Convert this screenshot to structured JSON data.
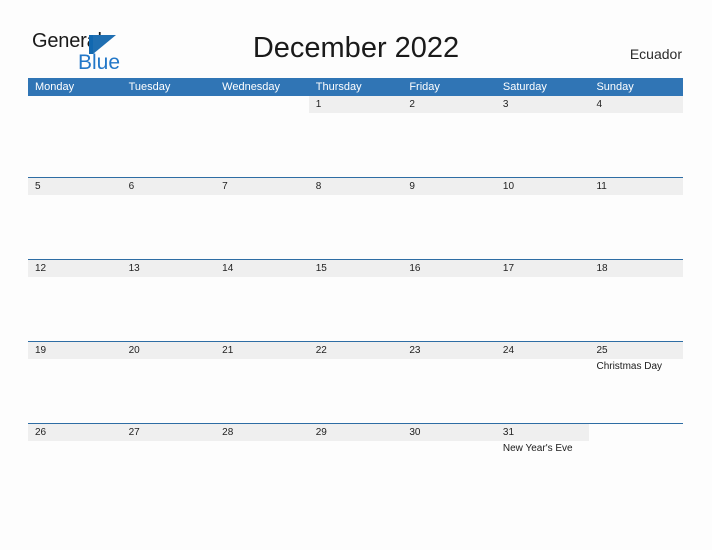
{
  "brand": {
    "name_part1": "General",
    "name_part2": "Blue",
    "mark_icon": "triangle-flag-icon",
    "accent_color": "#2277c8"
  },
  "header": {
    "title": "December 2022",
    "country": "Ecuador"
  },
  "theme": {
    "header_blue": "#3075b5",
    "rule_blue": "#2e6da4",
    "day_band_gray": "#efefef",
    "page_background": "#fdfdfd",
    "text_dark": "#222222"
  },
  "calendar": {
    "weekday_headers": [
      "Monday",
      "Tuesday",
      "Wednesday",
      "Thursday",
      "Friday",
      "Saturday",
      "Sunday"
    ],
    "weeks": [
      [
        {
          "day": "",
          "event": ""
        },
        {
          "day": "",
          "event": ""
        },
        {
          "day": "",
          "event": ""
        },
        {
          "day": "1",
          "event": ""
        },
        {
          "day": "2",
          "event": ""
        },
        {
          "day": "3",
          "event": ""
        },
        {
          "day": "4",
          "event": ""
        }
      ],
      [
        {
          "day": "5",
          "event": ""
        },
        {
          "day": "6",
          "event": ""
        },
        {
          "day": "7",
          "event": ""
        },
        {
          "day": "8",
          "event": ""
        },
        {
          "day": "9",
          "event": ""
        },
        {
          "day": "10",
          "event": ""
        },
        {
          "day": "11",
          "event": ""
        }
      ],
      [
        {
          "day": "12",
          "event": ""
        },
        {
          "day": "13",
          "event": ""
        },
        {
          "day": "14",
          "event": ""
        },
        {
          "day": "15",
          "event": ""
        },
        {
          "day": "16",
          "event": ""
        },
        {
          "day": "17",
          "event": ""
        },
        {
          "day": "18",
          "event": ""
        }
      ],
      [
        {
          "day": "19",
          "event": ""
        },
        {
          "day": "20",
          "event": ""
        },
        {
          "day": "21",
          "event": ""
        },
        {
          "day": "22",
          "event": ""
        },
        {
          "day": "23",
          "event": ""
        },
        {
          "day": "24",
          "event": ""
        },
        {
          "day": "25",
          "event": "Christmas Day"
        }
      ],
      [
        {
          "day": "26",
          "event": ""
        },
        {
          "day": "27",
          "event": ""
        },
        {
          "day": "28",
          "event": ""
        },
        {
          "day": "29",
          "event": ""
        },
        {
          "day": "30",
          "event": ""
        },
        {
          "day": "31",
          "event": "New Year's Eve"
        },
        {
          "day": "",
          "event": ""
        }
      ]
    ]
  }
}
